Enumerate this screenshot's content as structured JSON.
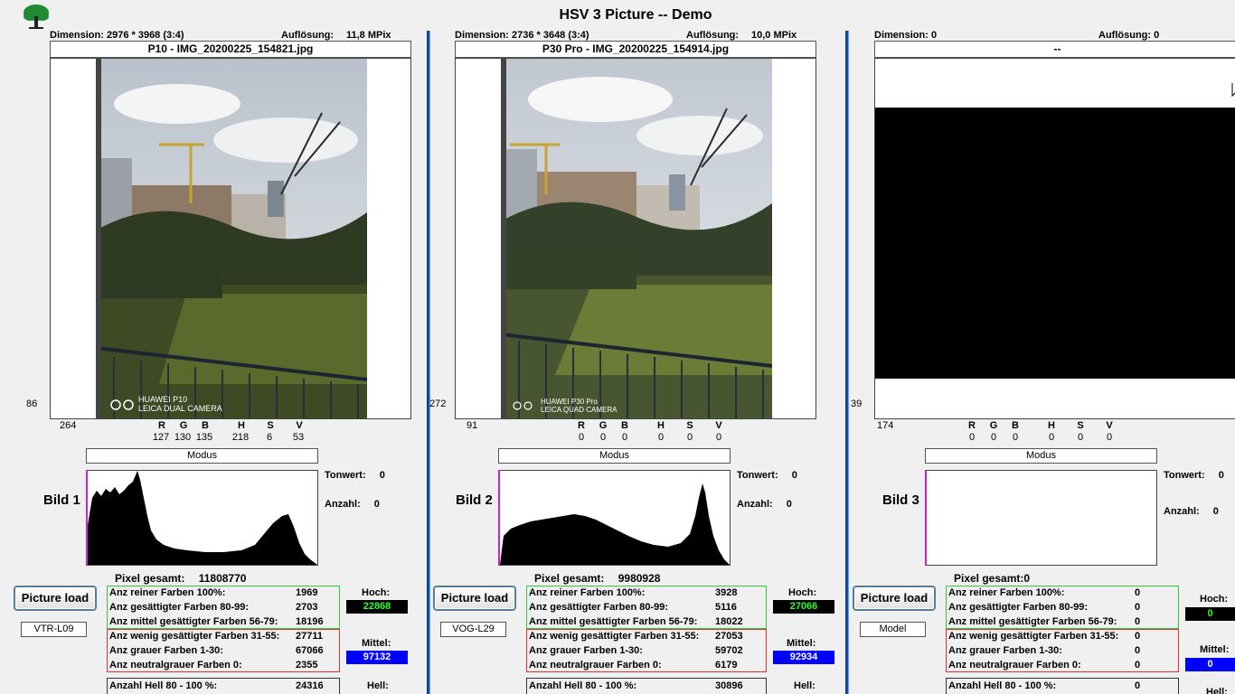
{
  "app": {
    "title": "HSV 3 Picture -- Demo",
    "logo": "tree-logo-icon"
  },
  "colors": {
    "divider": "#0b4fb3",
    "hoch_box": "#000000",
    "hoch_text": "#2cff2c",
    "mittel_box": "#0000ff",
    "green_group": "#2ecc40",
    "red_group": "#e03030",
    "hist_axis": "#d020d0"
  },
  "labels": {
    "aufloesung": "Auflösung:",
    "dimension": "Dimension:",
    "modus": "Modus",
    "tonwert": "Tonwert:",
    "anzahl": "Anzahl:",
    "pixel_gesamt": "Pixel gesamt:",
    "pixel_gesamt_nospace": "Pixel gesamt:",
    "picture_load": "Picture load",
    "hoch": "Hoch:",
    "mittel": "Mittel:",
    "hell": "Hell:",
    "r": "R",
    "g": "G",
    "b": "B",
    "h": "H",
    "s": "S",
    "v": "V",
    "rows": [
      "Anz reiner Farben 100%:",
      "Anz gesättigter Farben 80-99:",
      "Anz mittel gesättigter Farben 56-79:",
      "Anz wenig gesättigter Farben 31-55:",
      "Anz grauer Farben 1-30:",
      "Anz neutralgrauer Farben 0:",
      "Anzahl Hell 80 - 100 %:"
    ]
  },
  "panels": [
    {
      "dimension_value": "2976 * 3968 (3:4)",
      "aufloesung_value": "11,8 MPix",
      "filename": "P10 - IMG_20200225_154821.jpg",
      "side_num": "86",
      "bottom_num": "264",
      "watermark": [
        "HUAWEI P10",
        "LEICA DUAL CAMERA"
      ],
      "rgb": [
        "127",
        "130",
        "135"
      ],
      "hsv": [
        "218",
        "6",
        "53"
      ],
      "bild": "Bild 1",
      "tonwert": "0",
      "anzahl": "0",
      "pixel_gesamt": "11808770",
      "model": "VTR-L09",
      "counts": [
        "1969",
        "2703",
        "18196",
        "27711",
        "67066",
        "2355",
        "24316"
      ],
      "hoch": "22868",
      "mittel": "97132"
    },
    {
      "dimension_value": "2736 * 3648 (3:4)",
      "aufloesung_value": "10,0 MPix",
      "filename": "P30 Pro - IMG_20200225_154914.jpg",
      "side_num": "272",
      "bottom_num": "91",
      "watermark": [
        "HUAWEI P30 Pro",
        "LEICA QUAD CAMERA"
      ],
      "rgb": [
        "0",
        "0",
        "0"
      ],
      "hsv": [
        "0",
        "0",
        "0"
      ],
      "bild": "Bild 2",
      "tonwert": "0",
      "anzahl": "0",
      "pixel_gesamt": "9980928",
      "model": "VOG-L29",
      "counts": [
        "3928",
        "5116",
        "18022",
        "27053",
        "59702",
        "6179",
        "30896"
      ],
      "hoch": "27066",
      "mittel": "92934"
    },
    {
      "dimension_value": "0",
      "aufloesung_value": "0",
      "filename": "--",
      "side_num": "39",
      "bottom_num": "174",
      "rgb": [
        "0",
        "0",
        "0"
      ],
      "hsv": [
        "0",
        "0",
        "0"
      ],
      "bild": "Bild 3",
      "tonwert": "0",
      "anzahl": "0",
      "pixel_gesamt": "0",
      "model": "Model",
      "counts": [
        "0",
        "0",
        "0",
        "0",
        "0",
        "0",
        "0"
      ],
      "hoch": "0",
      "mittel": "0"
    }
  ]
}
